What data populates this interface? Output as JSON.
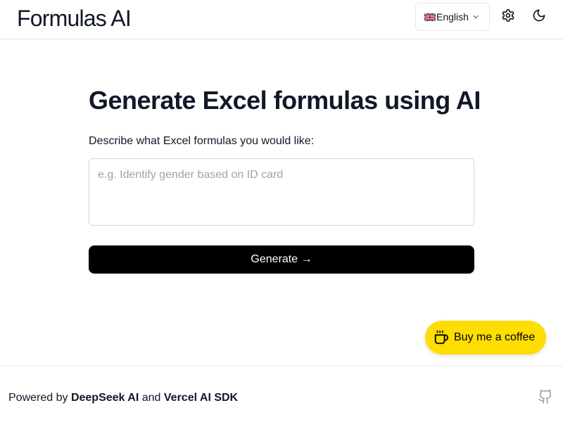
{
  "header": {
    "logo": "Formulas AI",
    "language": {
      "flag": "🇬🇧",
      "label": "English"
    },
    "icons": [
      "settings-icon",
      "moon-icon",
      "chevron-down-icon"
    ]
  },
  "main": {
    "title": "Generate Excel formulas using AI",
    "prompt_label": "Describe what Excel formulas you would like:",
    "input_value": "",
    "input_placeholder": "e.g. Identify gender based on ID card",
    "generate_label": "Generate →"
  },
  "coffee_button": {
    "label": "Buy me a coffee",
    "color": "#fedd03",
    "icon": "coffee-cup-icon"
  },
  "footer": {
    "prefix": "Powered by ",
    "brand1": "DeepSeek AI",
    "middle": " and ",
    "brand2": "Vercel AI SDK",
    "icon": "github-icon"
  }
}
